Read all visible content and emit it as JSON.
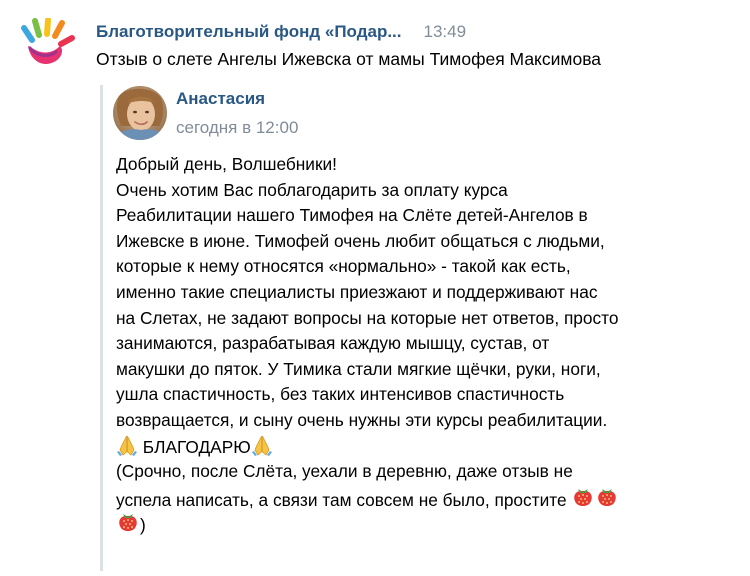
{
  "post": {
    "group_name": "Благотворительный фонд «Подар...",
    "time": "13:49",
    "title": "Отзыв о слете Ангелы Ижевска от мамы Тимофея Максимова"
  },
  "repost": {
    "author_name": "Анастасия",
    "author_date": "сегодня в 12:00",
    "lines": [
      "Добрый день, Волшебники!",
      "Очень хотим Вас поблагодарить за оплату курса",
      "Реабилитации нашего Тимофея на Слёте детей-Ангелов в",
      "Ижевске в июне. Тимофей очень любит общаться с людьми,",
      "которые к нему относятся «нормально» - такой как есть,",
      "именно такие специалисты приезжают и поддерживают нас",
      "на Слетах, не задают вопросы на которые нет ответов, просто",
      "занимаются, разрабатывая каждую мышцу, сустав, от",
      "макушки до пяток. У Тимика стали мягкие щёчки, руки, ноги,",
      "ушла спастичность, без таких интенсивов спастичность",
      "возвращается, и сыну очень нужны эти курсы реабилитации."
    ],
    "thanks_text": " БЛАГОДАРЮ",
    "closing_line_1": "(Срочно, после Слёта, уехали в деревню, даже отзыв не",
    "closing_line_2": "успела написать, а связи там совсем не было, простите ",
    "closing_line_3_end": ")"
  },
  "icons": {
    "logo": "colorful-hand-logo-icon",
    "pray": "folded-hands-emoji-icon",
    "strawberry": "strawberry-emoji-icon"
  },
  "colors": {
    "link_blue": "#2a5885",
    "meta_gray": "#818c99",
    "quote_bar": "#dce1e6"
  }
}
